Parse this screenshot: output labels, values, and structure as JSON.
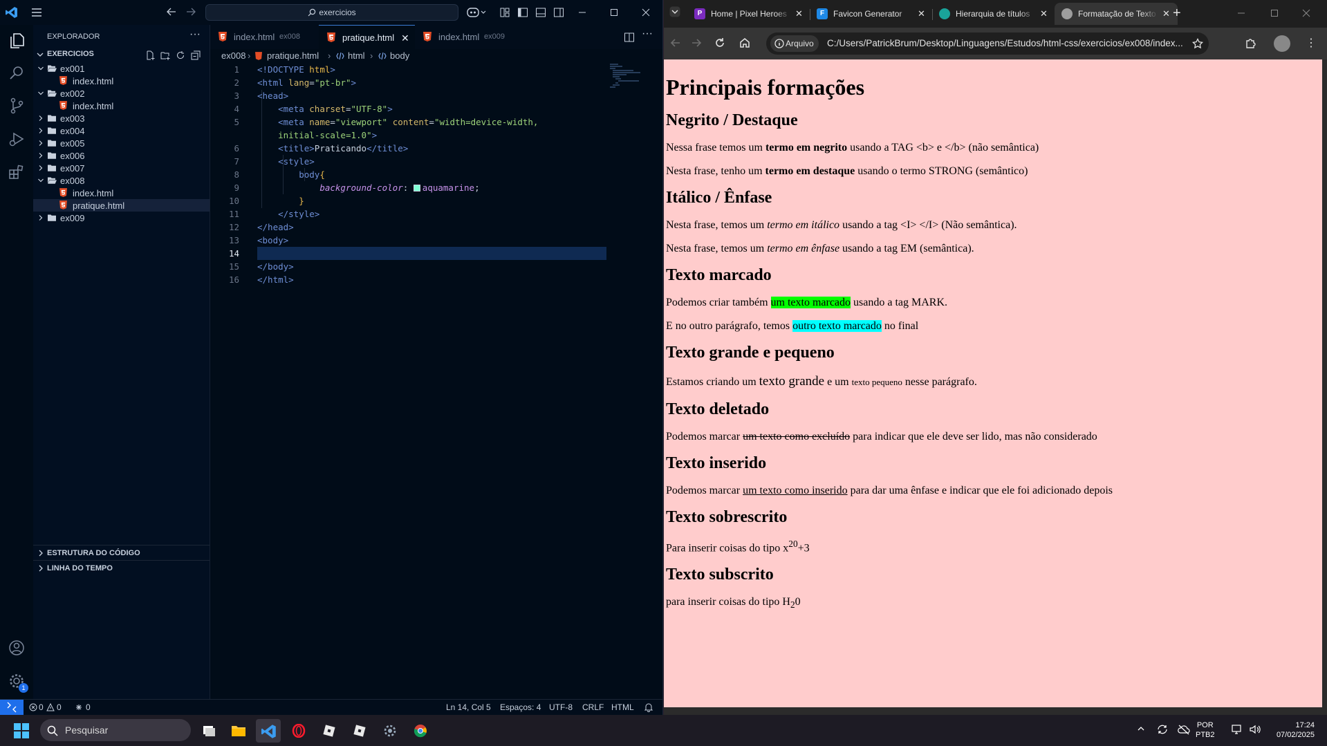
{
  "vscode": {
    "search_text": "exercicios",
    "explorer_title": "EXPLORADOR",
    "workspace_name": "EXERCICIOS",
    "tree": [
      {
        "label": "ex001",
        "type": "folder",
        "expanded": true,
        "depth": 0
      },
      {
        "label": "index.html",
        "type": "file",
        "depth": 1
      },
      {
        "label": "ex002",
        "type": "folder",
        "expanded": true,
        "depth": 0
      },
      {
        "label": "index.html",
        "type": "file",
        "depth": 1
      },
      {
        "label": "ex003",
        "type": "folder",
        "expanded": false,
        "depth": 0
      },
      {
        "label": "ex004",
        "type": "folder",
        "expanded": false,
        "depth": 0
      },
      {
        "label": "ex005",
        "type": "folder",
        "expanded": false,
        "depth": 0
      },
      {
        "label": "ex006",
        "type": "folder",
        "expanded": false,
        "depth": 0
      },
      {
        "label": "ex007",
        "type": "folder",
        "expanded": false,
        "depth": 0
      },
      {
        "label": "ex008",
        "type": "folder",
        "expanded": true,
        "depth": 0
      },
      {
        "label": "index.html",
        "type": "file",
        "depth": 1
      },
      {
        "label": "pratique.html",
        "type": "file",
        "depth": 1,
        "active": true
      },
      {
        "label": "ex009",
        "type": "folder",
        "expanded": false,
        "depth": 0
      }
    ],
    "outline_label": "ESTRUTURA DO CÓDIGO",
    "timeline_label": "LINHA DO TEMPO",
    "tabs": [
      {
        "name": "index.html",
        "desc": "ex008",
        "active": false
      },
      {
        "name": "pratique.html",
        "desc": "",
        "active": true
      },
      {
        "name": "index.html",
        "desc": "ex009",
        "active": false
      }
    ],
    "breadcrumb": {
      "folder": "ex008",
      "file": "pratique.html",
      "node1": "html",
      "node2": "body"
    },
    "line_numbers": [
      "1",
      "2",
      "3",
      "4",
      "5",
      "",
      "6",
      "7",
      "8",
      "9",
      "10",
      "11",
      "12",
      "13",
      "14",
      "15",
      "16"
    ],
    "code": {
      "doctype_open": "<!DOCTYPE",
      "doctype_html": "html",
      "doctype_close": ">",
      "html_open": "<html",
      "lang_attr": "lang",
      "lang_val": "\"pt-br\"",
      "head_open": "<head>",
      "meta": "<meta",
      "charset_attr": "charset",
      "charset_val": "\"UTF-8\"",
      "name_attr": "name",
      "name_val": "\"viewport\"",
      "content_attr": "content",
      "content_val": "\"width=device-width,",
      "content_val2": "initial-scale=1.0\"",
      "title_open": "<title>",
      "title_text": "Praticando",
      "title_close": "</title>",
      "style_open": "<style>",
      "body_selector": "body",
      "brace_open": "{",
      "prop": "background-color",
      "colon": ":",
      "value": "aquamarine",
      "semicolon": ";",
      "brace_close": "}",
      "style_close": "</style>",
      "head_close": "</head>",
      "body_open": "<body>",
      "body_close": "</body>",
      "html_close": "</html>",
      "gt": ">",
      "eq": "="
    },
    "status": {
      "errors": "0",
      "warnings": "0",
      "ports": "0",
      "position": "Ln 14, Col 5",
      "spaces": "Espaços: 4",
      "encoding": "UTF-8",
      "eol": "CRLF",
      "language": "HTML"
    },
    "settings_badge": "1"
  },
  "chrome": {
    "tabs": [
      {
        "title": "Home | Pixel Heroes",
        "favicon_letter": "P",
        "favicon_color": "#7b2cbf",
        "active": false
      },
      {
        "title": "Favicon Generator",
        "favicon_letter": "F",
        "favicon_color": "#1e88e5",
        "active": false
      },
      {
        "title": "Hierarquia de títulos",
        "favicon_letter": "",
        "favicon_color": "#1aa39a",
        "active": false
      },
      {
        "title": "Formatação de Texto",
        "favicon_letter": "",
        "favicon_color": "#9e9e9e",
        "active": true
      }
    ],
    "security_chip": "Arquivo",
    "url": "C:/Users/PatrickBrum/Desktop/Linguagens/Estudos/html-css/exercicios/ex008/index...",
    "page": {
      "h1": "Principais formações",
      "sections": [
        {
          "h2": "Negrito / Destaque"
        },
        {
          "h2": "Itálico / Ênfase"
        },
        {
          "h2": "Texto marcado"
        },
        {
          "h2": "Texto grande e pequeno"
        },
        {
          "h2": "Texto deletado"
        },
        {
          "h2": "Texto inserido"
        },
        {
          "h2": "Texto sobrescrito"
        },
        {
          "h2": "Texto subscrito"
        }
      ],
      "p_bold_pre": "Nessa frase temos um ",
      "p_bold_b": "termo em negrito",
      "p_bold_post": " usando a TAG <b> e </b> (não semântica)",
      "p_strong_pre": "Nesta frase, tenho um ",
      "p_strong_b": "termo em destaque",
      "p_strong_post": " usando o termo STRONG (semântico)",
      "p_i_pre": "Nesta frase, temos um ",
      "p_i_i": "termo em itálico",
      "p_i_post": " usando a tag <I> </I> (Não semântica).",
      "p_em_pre": "Nesta frase, temos um ",
      "p_em_em": "termo em ênfase",
      "p_em_post": " usando a tag EM (semântica).",
      "p_mark1_pre": "Podemos criar também ",
      "p_mark1_mark": "um texto marcado",
      "p_mark1_post": " usando a tag MARK.",
      "p_mark2_pre": "E no outro parágrafo, temos ",
      "p_mark2_mark": "outro texto marcado",
      "p_mark2_post": " no final",
      "p_size_pre": "Estamos criando um ",
      "p_size_big": "texto grande",
      "p_size_mid": " e um ",
      "p_size_small": "texto pequeno",
      "p_size_post": " nesse parágrafo.",
      "p_del_pre": "Podemos marcar ",
      "p_del_del": "um texto como excluído",
      "p_del_post": " para indicar que ele deve ser lido, mas não considerado",
      "p_ins_pre": "Podemos marcar ",
      "p_ins_ins": "um texto como inserido",
      "p_ins_post": " para dar uma ênfase e indicar que ele foi adicionado depois",
      "p_sup_pre": "Para inserir coisas do tipo x",
      "p_sup_sup": "20",
      "p_sup_post": "+3",
      "p_sub_pre": "para inserir coisas do tipo H",
      "p_sub_sub": "2",
      "p_sub_post": "0"
    }
  },
  "taskbar": {
    "search_placeholder": "Pesquisar",
    "lang1": "POR",
    "lang2": "PTB2",
    "time": "17:24",
    "date": "07/02/2025"
  },
  "colors": {
    "vscode_bg": "#010c18",
    "page_bg": "#ffcccc",
    "mark_green": "#00ff00",
    "mark_cyan": "#00ffff",
    "accent": "#1f6feb"
  }
}
